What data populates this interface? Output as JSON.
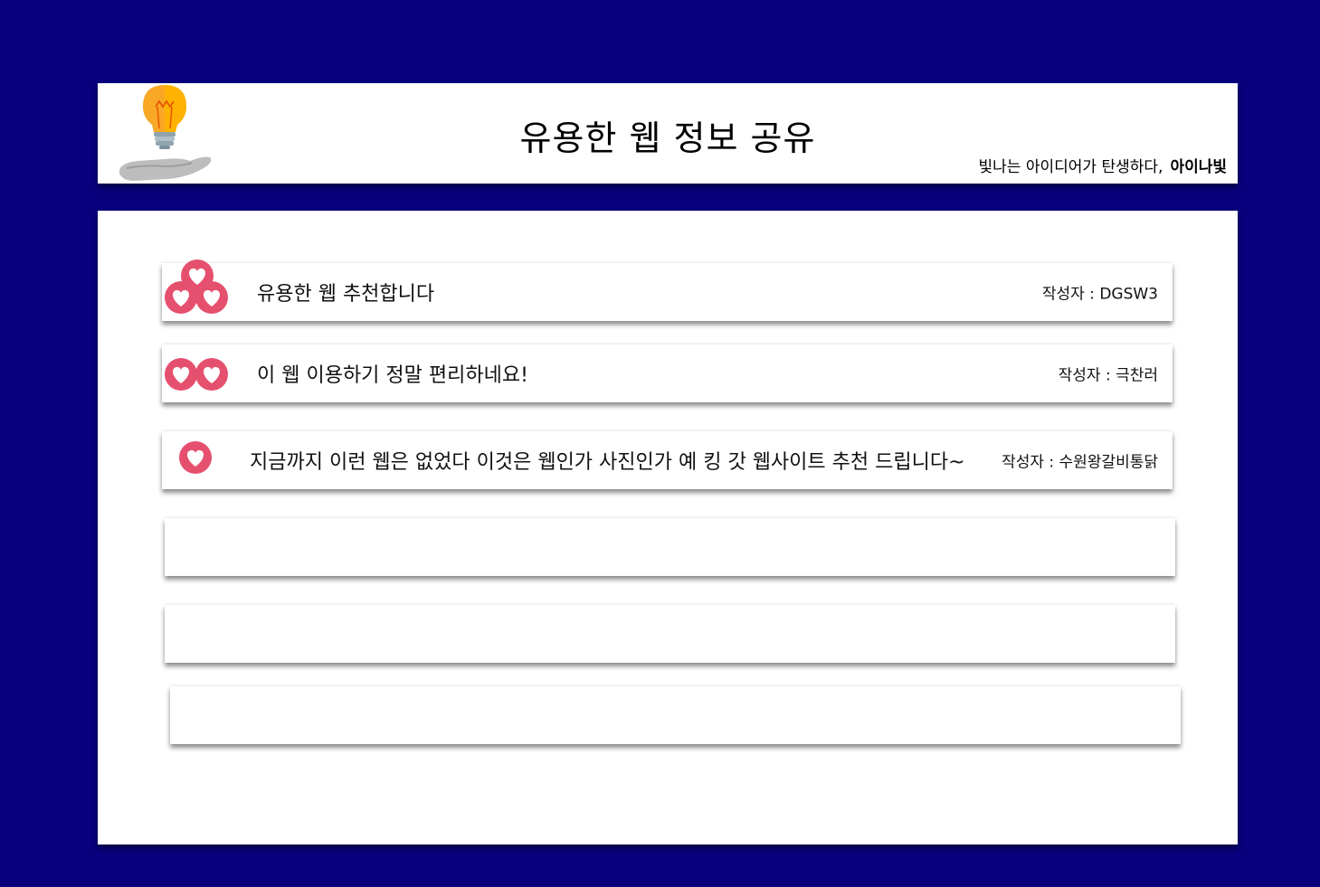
{
  "header": {
    "title": "유용한 웹 정보 공유",
    "tagline": "빛나는 아이디어가 탄생하다,",
    "brand": "아이나빛"
  },
  "posts": [
    {
      "title": "유용한 웹 추천합니다",
      "author": "작성자 : DGSW3",
      "likes": 3
    },
    {
      "title": "이 웹 이용하기 정말 편리하네요!",
      "author": "작성자 : 극찬러",
      "likes": 2
    },
    {
      "title": "지금까지 이런 웹은 없었다 이것은 웹인가 사진인가 예 킹 갓 웹사이트 추천 드립니다~",
      "author": "작성자 : 수원왕갈비통닭",
      "likes": 1
    }
  ],
  "empty_rows": 3,
  "colors": {
    "background": "#08007c",
    "heart": "#e5506e",
    "bulb": "#f9a825"
  },
  "icons": [
    "lightbulb-hand-logo",
    "heart-icon"
  ]
}
